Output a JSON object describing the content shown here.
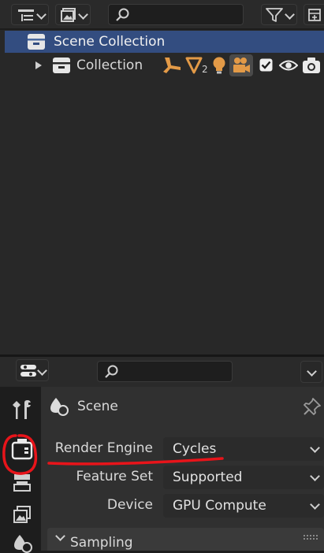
{
  "outliner": {
    "scene_collection": "Scene Collection",
    "collection": "Collection",
    "mesh_count": "2"
  },
  "properties": {
    "context_title": "Scene",
    "render_engine": {
      "label": "Render Engine",
      "value": "Cycles"
    },
    "feature_set": {
      "label": "Feature Set",
      "value": "Supported"
    },
    "device": {
      "label": "Device",
      "value": "GPU Compute"
    },
    "panel_sampling": "Sampling"
  },
  "colors": {
    "selection": "#334d80",
    "orange_icon": "#e39a47",
    "annotation": "#e8141a"
  }
}
